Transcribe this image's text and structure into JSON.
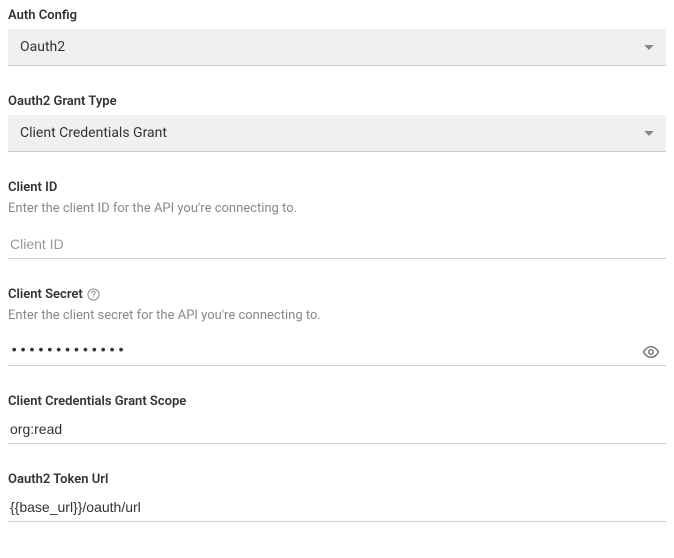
{
  "auth_config": {
    "label": "Auth Config",
    "value": "Oauth2"
  },
  "grant_type": {
    "label": "Oauth2 Grant Type",
    "value": "Client Credentials Grant"
  },
  "client_id": {
    "label": "Client ID",
    "help": "Enter the client ID for the API you're connecting to.",
    "placeholder": "Client ID",
    "value": ""
  },
  "client_secret": {
    "label": "Client Secret",
    "help": "Enter the client secret for the API you're connecting to.",
    "masked_value": "•••••••••••••"
  },
  "scope": {
    "label": "Client Credentials Grant Scope",
    "value": "org:read"
  },
  "token_url": {
    "label": "Oauth2 Token Url",
    "value": "{{base_url}}/oauth/url"
  }
}
